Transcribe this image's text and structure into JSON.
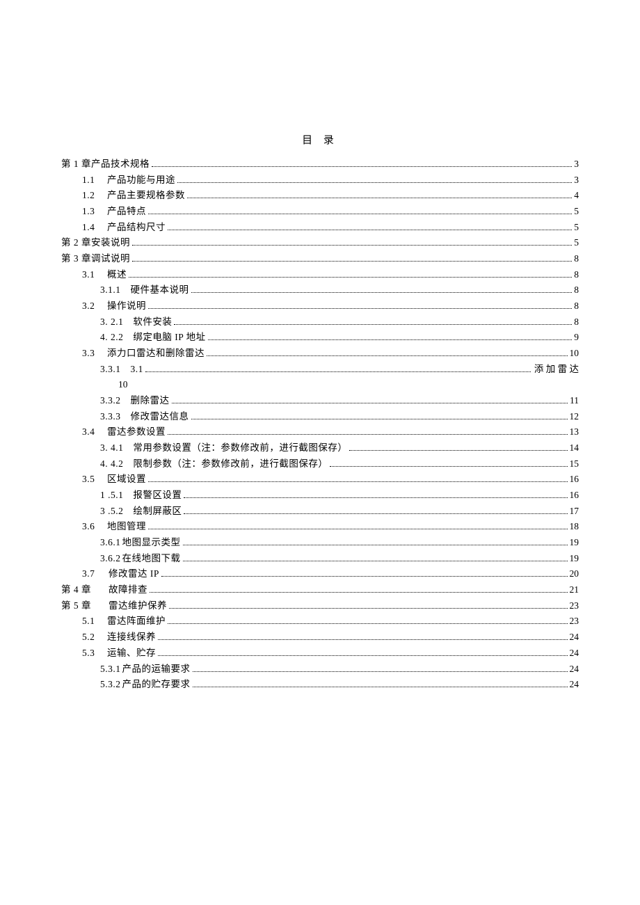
{
  "title": "目 录",
  "entries": [
    {
      "indent": 0,
      "num": "第 1 章",
      "text": "产品技术规格",
      "page": "3"
    },
    {
      "indent": 1,
      "num": "1.1",
      "text": "产品功能与用途",
      "page": "3"
    },
    {
      "indent": 1,
      "num": "1.2",
      "text": "产品主要规格参数",
      "page": "4"
    },
    {
      "indent": 1,
      "num": "1.3",
      "text": "产品特点",
      "page": "5"
    },
    {
      "indent": 1,
      "num": "1.4",
      "text": "产品结构尺寸",
      "page": "5"
    },
    {
      "indent": 0,
      "num": "第 2 章",
      "text": "安装说明",
      "page": "5"
    },
    {
      "indent": 0,
      "num": "第 3 章",
      "text": "调试说明",
      "page": "8"
    },
    {
      "indent": 1,
      "num": "3.1",
      "text": "概述",
      "page": "8"
    },
    {
      "indent": 2,
      "num": "3.1.1",
      "text": "硬件基本说明",
      "page": "8"
    },
    {
      "indent": 1,
      "num": "3.2",
      "text": "操作说明",
      "page": "8"
    },
    {
      "indent": 2,
      "num": "3.  2.1",
      "text": "软件安装",
      "page": "8"
    },
    {
      "indent": 2,
      "num": "4.  2.2",
      "text": "绑定电脑 IP 地址",
      "page": "9"
    },
    {
      "indent": 1,
      "num": "3.3",
      "text": "添力口雷达和删除雷达",
      "page": "10"
    },
    {
      "indent": 2,
      "special331": true,
      "num": "3.3.1",
      "inline": "3.1",
      "after": "添 加 雷 达",
      "sub": "10"
    },
    {
      "indent": 2,
      "num": "3.3.2",
      "text": "删除雷达",
      "page": "11"
    },
    {
      "indent": 2,
      "num": "3.3.3",
      "text": "修改雷达信息",
      "page": "12"
    },
    {
      "indent": 1,
      "num": "3.4",
      "text": "雷达参数设置",
      "page": "13"
    },
    {
      "indent": 2,
      "num": "3.  4.1",
      "text": "常用参数设置（注：参数修改前，进行截图保存）",
      "page": "14"
    },
    {
      "indent": 2,
      "num": "4.  4.2",
      "text": "限制参数（注：参数修改前，进行截图保存）",
      "page": "15"
    },
    {
      "indent": 1,
      "num": "3.5",
      "text": "区域设置",
      "page": "16"
    },
    {
      "indent": 2,
      "num": "1  .5.1",
      "text": "报警区设置",
      "page": "16"
    },
    {
      "indent": 2,
      "num": "3  .5.2",
      "text": "绘制屏蔽区",
      "page": "17"
    },
    {
      "indent": 1,
      "num": "3.6",
      "text": "地图管理",
      "page": "18"
    },
    {
      "indent": 2,
      "num": "3.6.1",
      "text": "地图显示类型",
      "page": "19",
      "tight": true
    },
    {
      "indent": 2,
      "num": "3.6.2",
      "text": "在线地图下载",
      "page": "19",
      "tight": true
    },
    {
      "indent": 1,
      "num": "3.7",
      "text": "修改雷达 IP",
      "page": "20",
      "tight": true
    },
    {
      "indent": 0,
      "num": "第 4 章",
      "text": "故障排查",
      "page": "21",
      "numwide": true
    },
    {
      "indent": 0,
      "num": "第 5 章",
      "text": "雷达维护保养",
      "page": "23",
      "numwide": true
    },
    {
      "indent": 1,
      "num": "5.1",
      "text": "雷达阵面维护",
      "page": "23"
    },
    {
      "indent": 1,
      "num": "5.2",
      "text": "连接线保养",
      "page": "24"
    },
    {
      "indent": 1,
      "num": "5.3",
      "text": "运输、贮存",
      "page": "24"
    },
    {
      "indent": 2,
      "num": "5.3.1",
      "text": "产品的运输要求",
      "page": "24",
      "tight": true
    },
    {
      "indent": 2,
      "num": "5.3.2",
      "text": "产品的贮存要求",
      "page": "24",
      "tight": true
    }
  ]
}
